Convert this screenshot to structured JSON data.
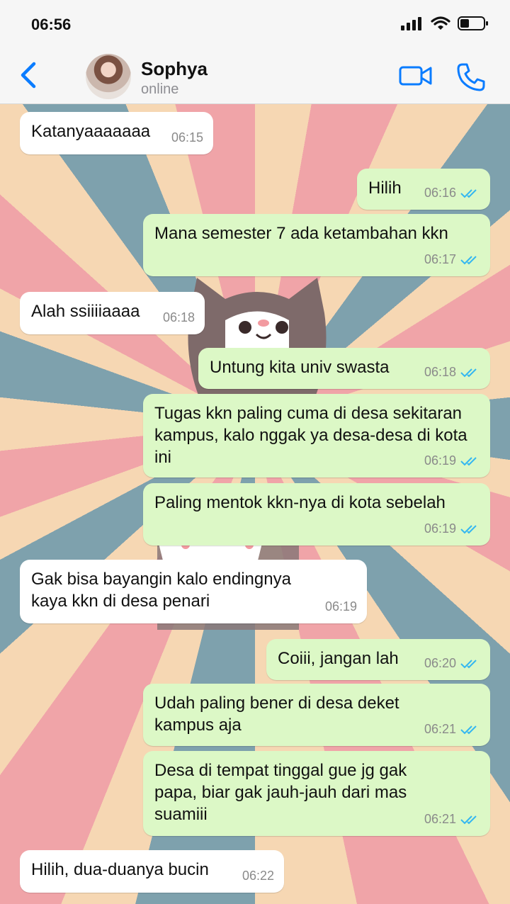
{
  "status_bar": {
    "time": "06:56"
  },
  "header": {
    "name": "Sophya",
    "status": "online"
  },
  "messages": [
    {
      "dir": "in",
      "text": "Katanyaaaaaaa",
      "time": "06:15"
    },
    {
      "dir": "out",
      "text": "Hilih",
      "time": "06:16"
    },
    {
      "dir": "out",
      "text": "Mana semester 7 ada ketambahan kkn",
      "time": "06:17"
    },
    {
      "dir": "in",
      "text": "Alah ssiiiiaaaa",
      "time": "06:18"
    },
    {
      "dir": "out",
      "text": "Untung kita univ swasta",
      "time": "06:18"
    },
    {
      "dir": "out",
      "text": "Tugas kkn paling cuma di desa sekitaran kampus, kalo nggak ya desa-desa di kota ini",
      "time": "06:19"
    },
    {
      "dir": "out",
      "text": "Paling mentok kkn-nya di kota sebelah",
      "time": "06:19"
    },
    {
      "dir": "in",
      "text": "Gak bisa bayangin kalo endingnya kaya kkn di desa penari",
      "time": "06:19"
    },
    {
      "dir": "out",
      "text": "Coiii, jangan lah",
      "time": "06:20"
    },
    {
      "dir": "out",
      "text": "Udah paling bener di desa deket kampus aja",
      "time": "06:21"
    },
    {
      "dir": "out",
      "text": "Desa di tempat tinggal gue jg gak papa, biar gak jauh-jauh dari mas suamiii",
      "time": "06:21"
    },
    {
      "dir": "in",
      "text": "Hilih, dua-duanya bucin",
      "time": "06:22"
    }
  ],
  "colors": {
    "accent": "#0a7cff",
    "outgoing": "#dcf8c6",
    "incoming": "#ffffff",
    "read_ticks": "#34b7f1"
  }
}
